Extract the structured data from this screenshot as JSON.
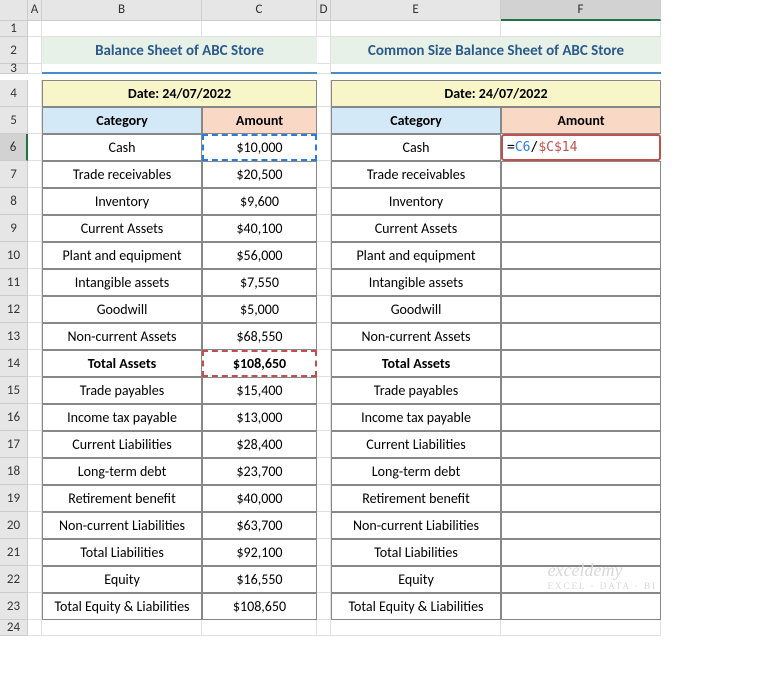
{
  "columns": [
    "",
    "A",
    "B",
    "C",
    "D",
    "E",
    "F"
  ],
  "selected_col": "F",
  "selected_row": "6",
  "title_left": "Balance Sheet of ABC Store",
  "title_right": "Common Size Balance Sheet of ABC Store",
  "date_label": "Date: 24/07/2022",
  "cat_label": "Category",
  "amt_label": "Amount",
  "rows_left": [
    {
      "cat": "Cash",
      "amt": "$10,000"
    },
    {
      "cat": "Trade receivables",
      "amt": "$20,500"
    },
    {
      "cat": "Inventory",
      "amt": "$9,600"
    },
    {
      "cat": "Current Assets",
      "amt": "$40,100"
    },
    {
      "cat": "Plant and equipment",
      "amt": "$56,000"
    },
    {
      "cat": "Intangible assets",
      "amt": "$7,550"
    },
    {
      "cat": "Goodwill",
      "amt": "$5,000"
    },
    {
      "cat": "Non-current Assets",
      "amt": "$68,550"
    },
    {
      "cat": "Total Assets",
      "amt": "$108,650",
      "bold": true
    },
    {
      "cat": "Trade payables",
      "amt": "$15,400"
    },
    {
      "cat": "Income tax payable",
      "amt": "$13,000"
    },
    {
      "cat": "Current Liabilities",
      "amt": "$28,400"
    },
    {
      "cat": "Long-term debt",
      "amt": "$23,700"
    },
    {
      "cat": "Retirement benefit",
      "amt": "$40,000"
    },
    {
      "cat": "Non-current Liabilities",
      "amt": "$63,700"
    },
    {
      "cat": "Total Liabilities",
      "amt": "$92,100"
    },
    {
      "cat": "Equity",
      "amt": "$16,550"
    },
    {
      "cat": "Total Equity & Liabilities",
      "amt": "$108,650"
    }
  ],
  "rows_right": [
    {
      "cat": "Cash",
      "amt": ""
    },
    {
      "cat": "Trade receivables",
      "amt": ""
    },
    {
      "cat": "Inventory",
      "amt": ""
    },
    {
      "cat": "Current Assets",
      "amt": ""
    },
    {
      "cat": "Plant and equipment",
      "amt": ""
    },
    {
      "cat": "Intangible assets",
      "amt": ""
    },
    {
      "cat": "Goodwill",
      "amt": ""
    },
    {
      "cat": "Non-current Assets",
      "amt": ""
    },
    {
      "cat": "Total Assets",
      "amt": "",
      "bold": true
    },
    {
      "cat": "Trade payables",
      "amt": ""
    },
    {
      "cat": "Income tax payable",
      "amt": ""
    },
    {
      "cat": "Current Liabilities",
      "amt": ""
    },
    {
      "cat": "Long-term debt",
      "amt": ""
    },
    {
      "cat": "Retirement benefit",
      "amt": ""
    },
    {
      "cat": "Non-current Liabilities",
      "amt": ""
    },
    {
      "cat": "Total Liabilities",
      "amt": ""
    },
    {
      "cat": "Equity",
      "amt": ""
    },
    {
      "cat": "Total Equity & Liabilities",
      "amt": ""
    }
  ],
  "formula": {
    "eq": "=",
    "ref1": "C6",
    "op": "/",
    "ref2": "$C$14"
  },
  "watermark": "exceldemy",
  "watermark_sub": "EXCEL · DATA · BI",
  "chart_data": {
    "type": "table",
    "title": "Balance Sheet of ABC Store",
    "date": "24/07/2022",
    "categories": [
      "Cash",
      "Trade receivables",
      "Inventory",
      "Current Assets",
      "Plant and equipment",
      "Intangible assets",
      "Goodwill",
      "Non-current Assets",
      "Total Assets",
      "Trade payables",
      "Income tax payable",
      "Current Liabilities",
      "Long-term debt",
      "Retirement benefit",
      "Non-current Liabilities",
      "Total Liabilities",
      "Equity",
      "Total Equity & Liabilities"
    ],
    "values": [
      10000,
      20500,
      9600,
      40100,
      56000,
      7550,
      5000,
      68550,
      108650,
      15400,
      13000,
      28400,
      23700,
      40000,
      63700,
      92100,
      16550,
      108650
    ]
  }
}
